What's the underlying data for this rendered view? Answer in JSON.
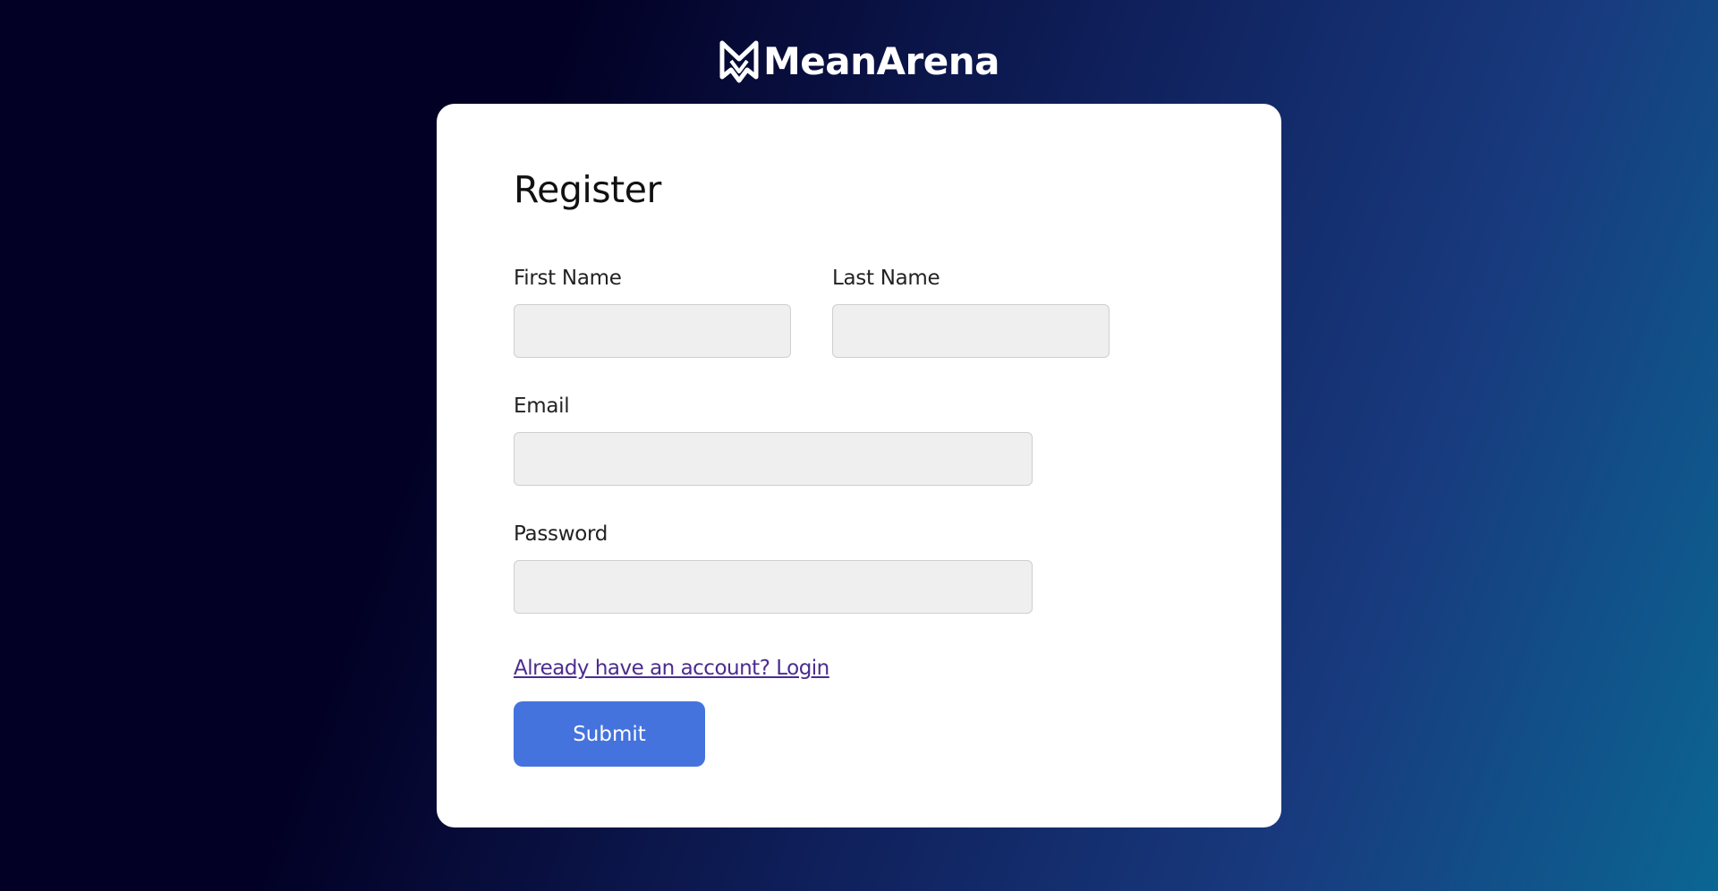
{
  "brand": {
    "name": "MeanArena",
    "logo_icon": "meanarena-logo-icon"
  },
  "form": {
    "title": "Register",
    "fields": {
      "first_name": {
        "label": "First Name",
        "value": "",
        "placeholder": ""
      },
      "last_name": {
        "label": "Last Name",
        "value": "",
        "placeholder": ""
      },
      "email": {
        "label": "Email",
        "value": "",
        "placeholder": ""
      },
      "password": {
        "label": "Password",
        "value": "",
        "placeholder": ""
      }
    },
    "login_link": "Already have an account? Login",
    "submit_label": "Submit"
  },
  "colors": {
    "background_start": "#020024",
    "background_end": "#0b6693",
    "card": "#ffffff",
    "input_bg": "#f0eff0",
    "button": "#4573dd",
    "link": "#4b2b91"
  }
}
